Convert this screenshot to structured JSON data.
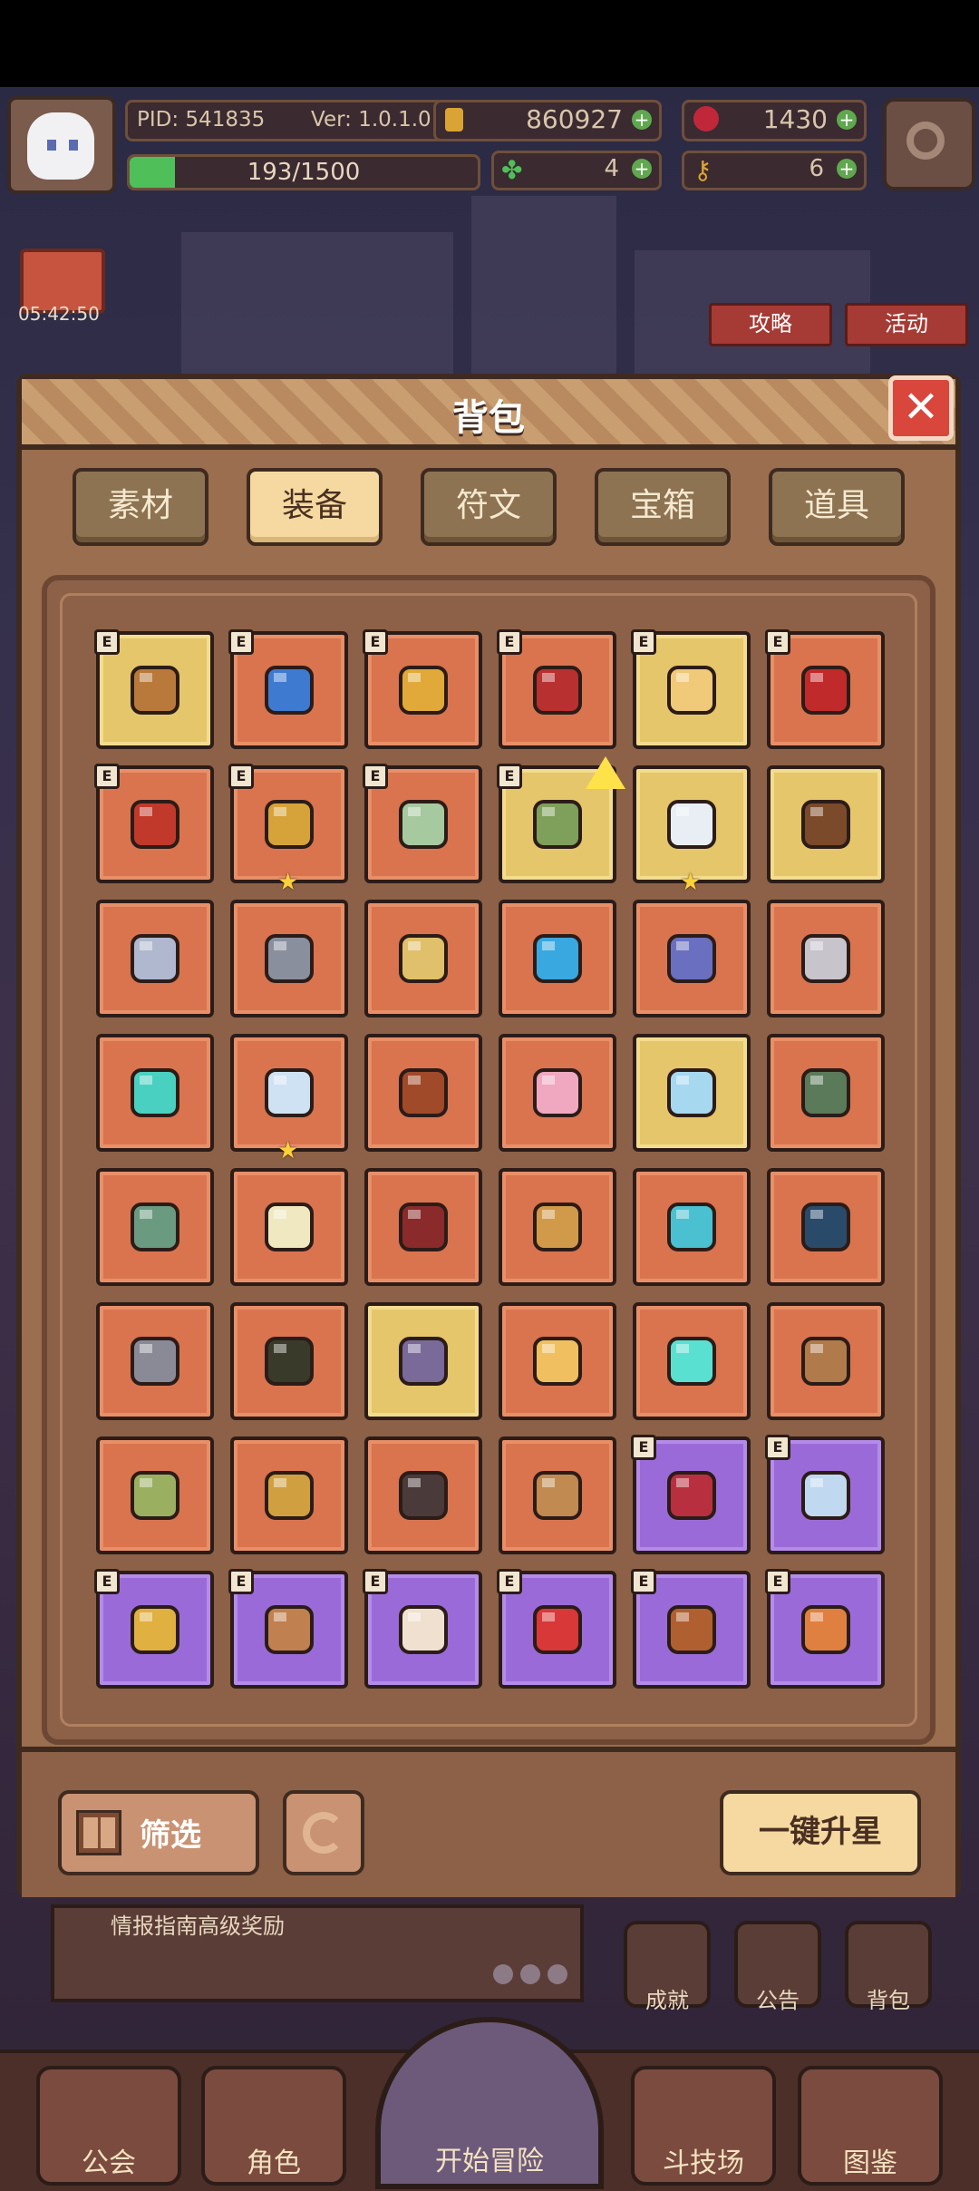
{
  "hud": {
    "pid": "PID: 541835",
    "version": "Ver: 1.0.1.0",
    "gold": "860927",
    "gems": "1430",
    "xp": "193/1500",
    "xp_fraction": 0.129,
    "clover": "4",
    "key": "6",
    "timer": "05:42:50",
    "guide_label": "攻略",
    "event_label": "活动"
  },
  "modal": {
    "title": "背包",
    "close_label": "✕",
    "tabs": [
      "素材",
      "装备",
      "符文",
      "宝箱",
      "道具"
    ],
    "active_tab": "装备",
    "filter_label": "筛选",
    "upgrade_all_label": "一键升星",
    "badge_letter": "E"
  },
  "items": [
    {
      "name": "golden-scepter",
      "rarity": "gold",
      "badge": true,
      "star": false,
      "color": "#b8793a"
    },
    {
      "name": "magic-lamp",
      "rarity": "orange",
      "badge": true,
      "star": false,
      "color": "#3d7ad0"
    },
    {
      "name": "gold-ring",
      "rarity": "orange",
      "badge": true,
      "star": false,
      "color": "#e0a93a"
    },
    {
      "name": "red-armor",
      "rarity": "orange",
      "badge": true,
      "star": false,
      "color": "#b83030"
    },
    {
      "name": "sun-ring",
      "rarity": "gold",
      "badge": true,
      "star": false,
      "color": "#f0c979"
    },
    {
      "name": "red-gauntlet",
      "rarity": "orange",
      "badge": true,
      "star": false,
      "color": "#c02a2a"
    },
    {
      "name": "ruby-necklace",
      "rarity": "orange",
      "badge": true,
      "star": false,
      "color": "#c0392b"
    },
    {
      "name": "twin-flasks",
      "rarity": "orange",
      "badge": true,
      "star": true,
      "color": "#d6a33a"
    },
    {
      "name": "jade-boots",
      "rarity": "orange",
      "badge": true,
      "star": false,
      "color": "#a6c9a0"
    },
    {
      "name": "green-amulet",
      "rarity": "gold",
      "badge": true,
      "star": false,
      "color": "#7fa05a",
      "up": true
    },
    {
      "name": "silver-wand",
      "rarity": "gold",
      "badge": false,
      "star": true,
      "color": "#e8eef4"
    },
    {
      "name": "sapphire-staff",
      "rarity": "gold",
      "badge": false,
      "star": false,
      "color": "#7a4a2a"
    },
    {
      "name": "steel-sword",
      "rarity": "orange",
      "badge": false,
      "star": false,
      "color": "#b0b8d0"
    },
    {
      "name": "dark-sword",
      "rarity": "orange",
      "badge": false,
      "star": false,
      "color": "#8a8f9e"
    },
    {
      "name": "golden-sword",
      "rarity": "orange",
      "badge": false,
      "star": false,
      "color": "#e0c06a"
    },
    {
      "name": "orb-staff",
      "rarity": "orange",
      "badge": false,
      "star": false,
      "color": "#3aa8e0"
    },
    {
      "name": "blue-crossbow",
      "rarity": "orange",
      "badge": false,
      "star": false,
      "color": "#6a6fc0"
    },
    {
      "name": "stone-armor",
      "rarity": "orange",
      "badge": false,
      "star": false,
      "color": "#c8c4cc"
    },
    {
      "name": "cyan-orb",
      "rarity": "orange",
      "badge": false,
      "star": false,
      "color": "#4ad0c0"
    },
    {
      "name": "crystal-crown",
      "rarity": "orange",
      "badge": false,
      "star": true,
      "color": "#cfe2f4"
    },
    {
      "name": "gem-crown",
      "rarity": "orange",
      "badge": false,
      "star": false,
      "color": "#a04a2a"
    },
    {
      "name": "pink-robe",
      "rarity": "orange",
      "badge": false,
      "star": false,
      "color": "#f0a8c0"
    },
    {
      "name": "ice-armor",
      "rarity": "gold",
      "badge": false,
      "star": false,
      "color": "#a6d8f0"
    },
    {
      "name": "green-cloak",
      "rarity": "orange",
      "badge": false,
      "star": false,
      "color": "#5a7a5a"
    },
    {
      "name": "jade-plate",
      "rarity": "orange",
      "badge": false,
      "star": false,
      "color": "#6a9a80"
    },
    {
      "name": "holy-robe",
      "rarity": "orange",
      "badge": false,
      "star": false,
      "color": "#f0e8c0"
    },
    {
      "name": "demon-cloak",
      "rarity": "orange",
      "badge": false,
      "star": false,
      "color": "#8a2a2a"
    },
    {
      "name": "striped-bracer",
      "rarity": "orange",
      "badge": false,
      "star": false,
      "color": "#d09a4a"
    },
    {
      "name": "frost-boots",
      "rarity": "orange",
      "badge": false,
      "star": false,
      "color": "#4ac0d0"
    },
    {
      "name": "ruby-boots",
      "rarity": "orange",
      "badge": false,
      "star": false,
      "color": "#2a4a6a"
    },
    {
      "name": "iron-greaves",
      "rarity": "orange",
      "badge": false,
      "star": false,
      "color": "#8a8a96"
    },
    {
      "name": "leather-boots",
      "rarity": "orange",
      "badge": false,
      "star": false,
      "color": "#3a3a2a"
    },
    {
      "name": "violet-boots",
      "rarity": "gold",
      "badge": false,
      "star": false,
      "color": "#7a6a9a"
    },
    {
      "name": "sun-medal",
      "rarity": "orange",
      "badge": false,
      "star": false,
      "color": "#f0c060"
    },
    {
      "name": "aqua-gem",
      "rarity": "orange",
      "badge": false,
      "star": false,
      "color": "#5ae0d0"
    },
    {
      "name": "jade-pouch",
      "rarity": "orange",
      "badge": false,
      "star": false,
      "color": "#b07a4a"
    },
    {
      "name": "jade-necklace",
      "rarity": "orange",
      "badge": false,
      "star": false,
      "color": "#9ab060"
    },
    {
      "name": "heart-necklace",
      "rarity": "orange",
      "badge": false,
      "star": false,
      "color": "#d0a040"
    },
    {
      "name": "dark-ring",
      "rarity": "orange",
      "badge": false,
      "star": false,
      "color": "#4a3a3a"
    },
    {
      "name": "green-pot",
      "rarity": "orange",
      "badge": false,
      "star": false,
      "color": "#c08a50"
    },
    {
      "name": "crimson-bow",
      "rarity": "purple",
      "badge": true,
      "star": false,
      "color": "#b83040"
    },
    {
      "name": "azure-sword",
      "rarity": "purple",
      "badge": true,
      "star": false,
      "color": "#c0d8f0"
    },
    {
      "name": "gold-mace",
      "rarity": "purple",
      "badge": true,
      "star": false,
      "color": "#e0b040"
    },
    {
      "name": "wooden-staff",
      "rarity": "purple",
      "badge": true,
      "star": false,
      "color": "#c08050"
    },
    {
      "name": "crescent-necklace",
      "rarity": "purple",
      "badge": true,
      "star": false,
      "color": "#f0e0d0"
    },
    {
      "name": "slime-helm",
      "rarity": "purple",
      "badge": true,
      "star": false,
      "color": "#d83838"
    },
    {
      "name": "beast-armor",
      "rarity": "purple",
      "badge": true,
      "star": false,
      "color": "#b06030"
    },
    {
      "name": "jewel-armor",
      "rarity": "purple",
      "badge": true,
      "star": false,
      "color": "#e08040"
    }
  ],
  "bottom": {
    "notice_text": "情报指南高级奖励",
    "mini": [
      "成就",
      "公告",
      "背包"
    ],
    "nav": [
      "公会",
      "角色",
      "开始冒险",
      "斗技场",
      "图鉴"
    ]
  }
}
